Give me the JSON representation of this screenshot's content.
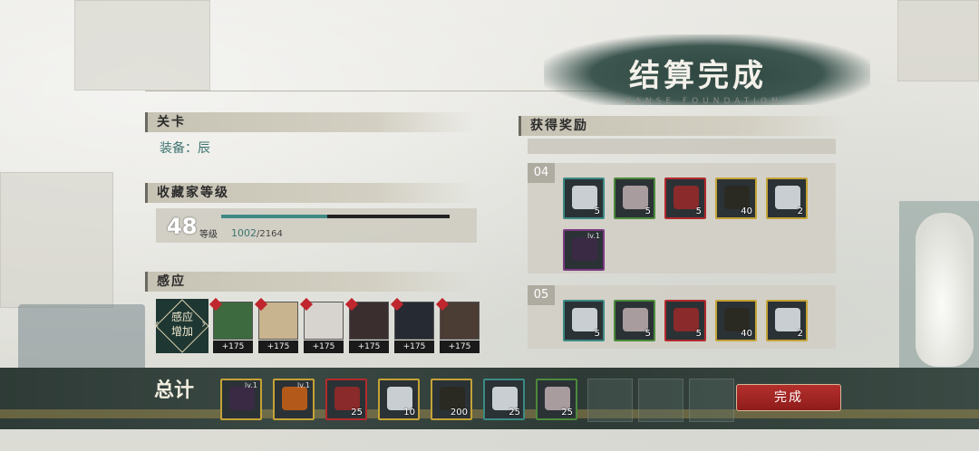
{
  "title": {
    "main": "结算完成",
    "sub": "KANSE FOUNDATION"
  },
  "stage": {
    "header": "关卡",
    "equip_text": "装备：辰"
  },
  "collector": {
    "header": "收藏家等级",
    "level": "48",
    "level_label": "等级",
    "exp_current": "1002",
    "exp_total": "/2164",
    "exp_fraction": 0.463
  },
  "induction": {
    "header": "感应",
    "button_label": "感应增加",
    "characters": [
      {
        "name": "character-1",
        "bonus": "+175",
        "color": "#3d6a3e"
      },
      {
        "name": "character-2",
        "bonus": "+175",
        "color": "#c8b48e"
      },
      {
        "name": "character-3",
        "bonus": "+175",
        "color": "#d7d4cf"
      },
      {
        "name": "character-4",
        "bonus": "+175",
        "color": "#3a2e2f"
      },
      {
        "name": "character-5",
        "bonus": "+175",
        "color": "#262a33"
      },
      {
        "name": "character-6",
        "bonus": "+175",
        "color": "#4b3c34"
      }
    ]
  },
  "rewards": {
    "header": "获得奖励",
    "boxes": [
      {
        "label": "04",
        "items": [
          {
            "icon": "cube-material-icon",
            "count": "5",
            "rarity": "teal"
          },
          {
            "icon": "ore-material-icon",
            "count": "5",
            "rarity": "green"
          },
          {
            "icon": "tool-material-icon",
            "count": "5",
            "rarity": "red"
          },
          {
            "icon": "badge-material-icon",
            "count": "40",
            "rarity": "gold"
          },
          {
            "icon": "cube-material-icon",
            "count": "2",
            "rarity": "gold"
          },
          {
            "icon": "gem-item-icon",
            "count": "",
            "level": "lv.1",
            "rarity": "purple"
          }
        ]
      },
      {
        "label": "05",
        "items": [
          {
            "icon": "cube-material-icon",
            "count": "5",
            "rarity": "teal"
          },
          {
            "icon": "ore-material-icon",
            "count": "5",
            "rarity": "green"
          },
          {
            "icon": "tool-material-icon",
            "count": "5",
            "rarity": "red"
          },
          {
            "icon": "badge-material-icon",
            "count": "40",
            "rarity": "gold"
          },
          {
            "icon": "cube-material-icon",
            "count": "2",
            "rarity": "gold"
          }
        ]
      }
    ]
  },
  "total": {
    "label": "总计",
    "items": [
      {
        "icon": "gem-item-icon",
        "count": "",
        "level": "lv.1",
        "rarity": "gold"
      },
      {
        "icon": "blade-item-icon",
        "count": "",
        "level": "lv.1",
        "rarity": "gold"
      },
      {
        "icon": "tool-material-icon",
        "count": "25",
        "rarity": "red"
      },
      {
        "icon": "cube-material-icon",
        "count": "10",
        "rarity": "gold"
      },
      {
        "icon": "badge-material-icon",
        "count": "200",
        "rarity": "gold"
      },
      {
        "icon": "cube-material-icon",
        "count": "25",
        "rarity": "teal"
      },
      {
        "icon": "ore-material-icon",
        "count": "25",
        "rarity": "green"
      }
    ]
  },
  "done_button": "完成"
}
